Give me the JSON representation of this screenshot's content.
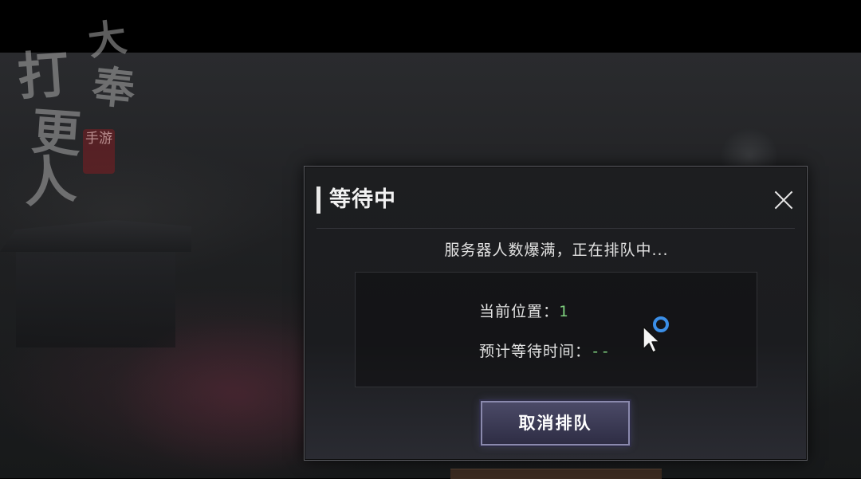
{
  "logo": {
    "chars": [
      "大",
      "奉",
      "打",
      "更",
      "人"
    ],
    "seal": "手游"
  },
  "dialog": {
    "title": "等待中",
    "message": "服务器人数爆满，正在排队中...",
    "position_label": "当前位置：",
    "position_value": "1",
    "wait_label": "预计等待时间：",
    "wait_value": "--",
    "cancel_label": "取消排队"
  },
  "icons": {
    "close": "close-icon",
    "spinner": "loading-spinner-icon",
    "cursor": "mouse-cursor-icon"
  },
  "colors": {
    "accent_green": "#7fd17f",
    "button_bg": "#3b3a54",
    "spinner_blue": "#3b8fe8"
  }
}
